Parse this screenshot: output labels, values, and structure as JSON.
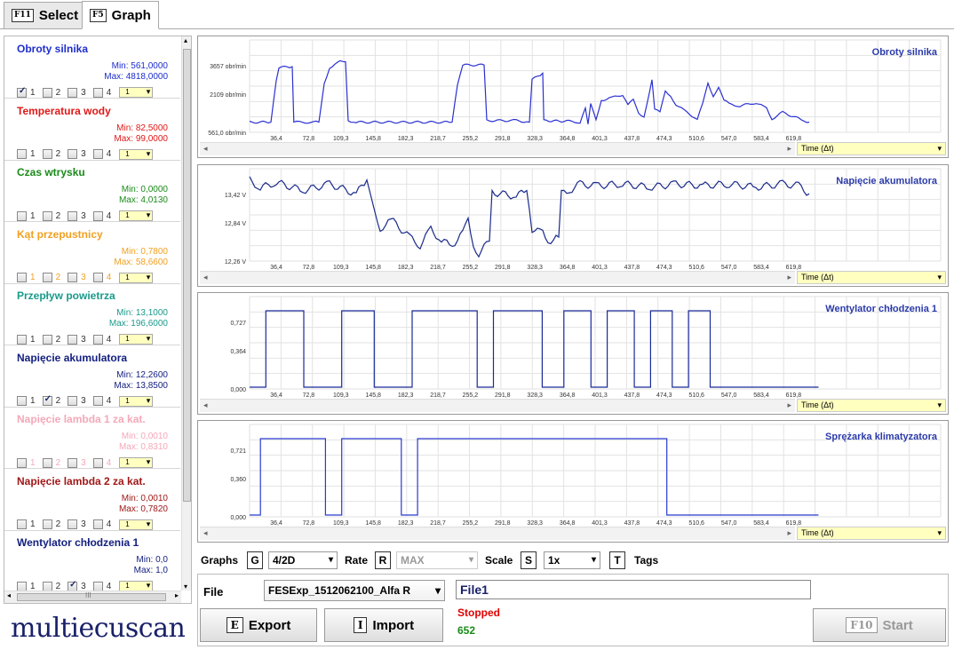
{
  "tabs": [
    {
      "key": "F11",
      "label": "Select"
    },
    {
      "key": "F5",
      "label": "Graph"
    }
  ],
  "channels": [
    {
      "name": "Obroty silnika",
      "color": "#1e2ecc",
      "min": "Min: 561,0000",
      "max": "Max: 4818,0000",
      "checked": [
        1
      ],
      "minmax_color": "#1e2ecc"
    },
    {
      "name": "Temperatura wody",
      "color": "#e01818",
      "min": "Min: 82,5000",
      "max": "Max: 99,0000",
      "checked": [],
      "minmax_color": "#e01818"
    },
    {
      "name": "Czas wtrysku",
      "color": "#1a8a1a",
      "min": "Min: 0,0000",
      "max": "Max: 4,0130",
      "checked": [],
      "minmax_color": "#1a8a1a"
    },
    {
      "name": "Kąt przepustnicy",
      "color": "#f0a020",
      "min": "Min: 0,7800",
      "max": "Max: 58,6600",
      "checked": [],
      "minmax_color": "#f0a020"
    },
    {
      "name": "Przepływ powietrza",
      "color": "#1a9a8a",
      "min": "Min: 13,1000",
      "max": "Max: 196,6000",
      "checked": [],
      "minmax_color": "#1a9a8a"
    },
    {
      "name": "Napięcie akumulatora",
      "color": "#142080",
      "min": "Min: 12,2600",
      "max": "Max: 13,8500",
      "checked": [
        2
      ],
      "minmax_color": "#142080"
    },
    {
      "name": "Napięcie lambda 1 za kat.",
      "color": "#f4a8b8",
      "min": "Min: 0,0010",
      "max": "Max: 0,8310",
      "checked": [],
      "minmax_color": "#f4a8b8"
    },
    {
      "name": "Napięcie lambda 2 za kat.",
      "color": "#a01818",
      "min": "Min: 0,0010",
      "max": "Max: 0,7820",
      "checked": [],
      "minmax_color": "#a01818"
    },
    {
      "name": "Wentylator chłodzenia 1",
      "color": "#142080",
      "min": "Min: 0,0",
      "max": "Max: 1,0",
      "checked": [
        3
      ],
      "minmax_color": "#142080"
    }
  ],
  "checkbox_labels": [
    "1",
    "2",
    "3",
    "4"
  ],
  "mini_value": "1",
  "list_hscroll_label": "III",
  "logo": "multiecuscan",
  "x_ticks": [
    "36,4",
    "72,8",
    "109,3",
    "145,8",
    "182,3",
    "218,7",
    "255,2",
    "291,8",
    "328,3",
    "364,8",
    "401,3",
    "437,8",
    "474,3",
    "510,6",
    "547,0",
    "583,4",
    "619,8"
  ],
  "graphs": [
    {
      "title": "Obroty silnika",
      "color": "#2a30d0",
      "y_labels": [
        "3657 obr/min",
        "2109 obr/min",
        "561,0 obr/min"
      ],
      "time_label": "Time (Δt)"
    },
    {
      "title": "Napięcie akumulatora",
      "color": "#1a2a8a",
      "y_labels": [
        "13,42 V",
        "12,84 V",
        "12,26 V"
      ],
      "time_label": "Time (Δt)"
    },
    {
      "title": "Wentylator chłodzenia 1",
      "color": "#1a2a9a",
      "y_labels": [
        "0,727",
        "0,364",
        "0,000"
      ],
      "time_label": "Time (Δt)"
    },
    {
      "title": "Sprężarka klimatyzatora",
      "color": "#2a3ad0",
      "y_labels": [
        "0,721",
        "0,360",
        "0,000"
      ],
      "time_label": "Time (Δt)"
    }
  ],
  "controls": {
    "graphs_label": "Graphs",
    "graphs_key": "G",
    "graphs_value": "4/2D",
    "rate_label": "Rate",
    "rate_key": "R",
    "rate_value": "MAX",
    "scale_label": "Scale",
    "scale_key": "S",
    "scale_value": "1x",
    "tags_key": "T",
    "tags_label": "Tags"
  },
  "bottom": {
    "file_label": "File",
    "file_value": "FESExp_1512062100_Alfa R",
    "export_key": "E",
    "export_label": "Export",
    "import_key": "I",
    "import_label": "Import",
    "name_value": "File1",
    "status": "Stopped",
    "count": "652",
    "start_key": "F10",
    "start_label": "Start"
  }
}
